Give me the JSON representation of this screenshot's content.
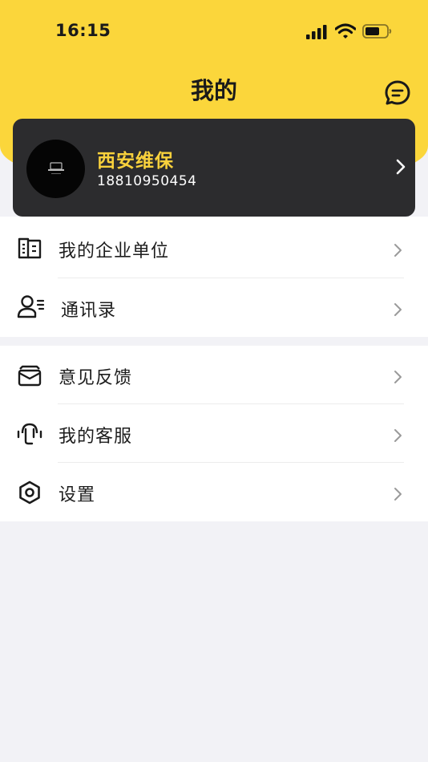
{
  "status_bar": {
    "time": "16:15"
  },
  "header": {
    "title": "我的",
    "accent_color": "#fbd63b"
  },
  "profile": {
    "name": "西安维保",
    "phone": "18810950454"
  },
  "menu_groups": [
    {
      "items": [
        {
          "label": "我的企业单位",
          "icon": "building-icon"
        },
        {
          "label": "通讯录",
          "icon": "contacts-icon"
        }
      ]
    },
    {
      "items": [
        {
          "label": "意见反馈",
          "icon": "mail-icon"
        },
        {
          "label": "我的客服",
          "icon": "headset-icon"
        },
        {
          "label": "设置",
          "icon": "settings-icon"
        }
      ]
    }
  ]
}
